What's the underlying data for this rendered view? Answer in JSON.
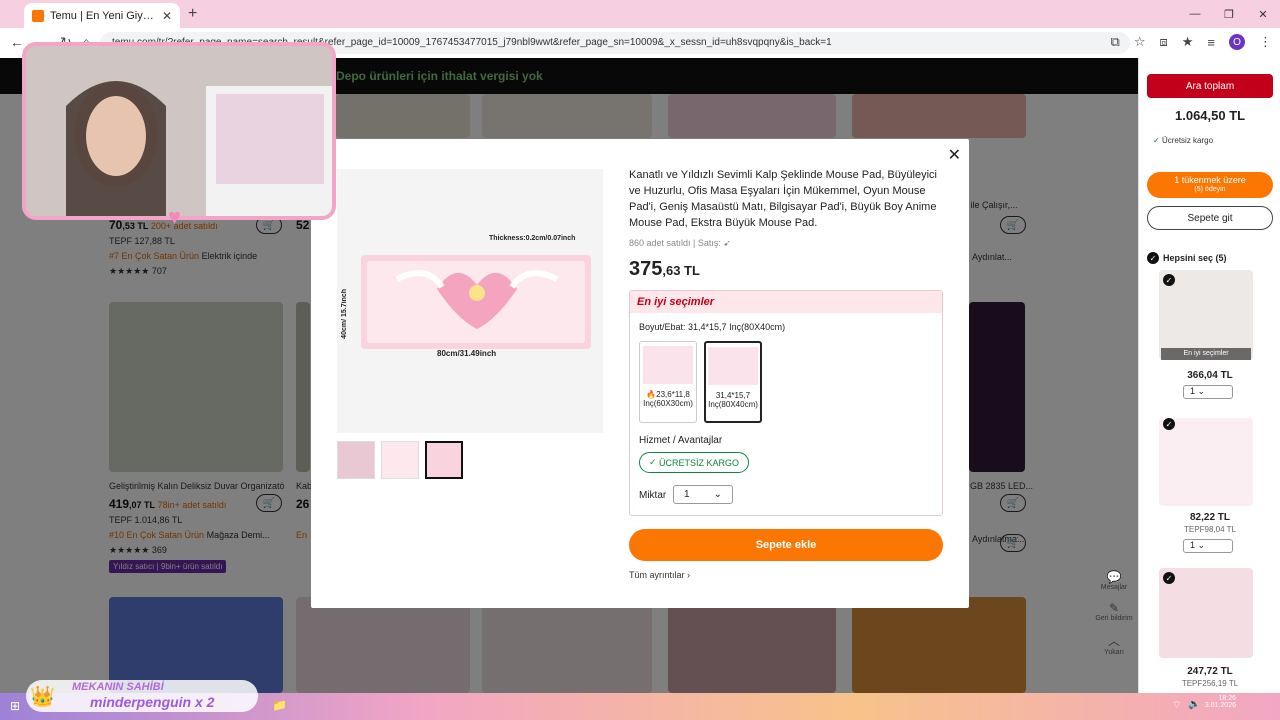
{
  "browser": {
    "tab_title": "Temu | En Yeni Giyim, Güzellik, Ev",
    "url": "temu.com/tr/?refer_page_name=search_result&refer_page_id=10009_1767453477015_j79nbl9wwt&refer_page_sn=10009&_x_sessn_id=uh8svqpqny&is_back=1",
    "profile_initial": "O"
  },
  "banner": {
    "text": "Depo ürünleri için ithalat vergisi yok"
  },
  "grid": {
    "items": [
      {
        "price_main": "70",
        "price_dec": ",53 TL",
        "sold": "200+ adet satıldı",
        "orig": "TEPF 127,88 TL",
        "rank": "#7 En Çok Satan Ürün",
        "rank_cat": "Elektrik içinde",
        "rating_count": "707"
      },
      {
        "title": "Geliştirilmiş Kalın Deliksiz Duvar Organizatö...",
        "price_main": "419",
        "price_dec": ",07 TL",
        "sold": "78in+ adet satıldı",
        "orig": "TEPF 1.014,86 TL",
        "rank": "#10 En Çok Satan Ürün",
        "rank_cat": "Mağaza Demi...",
        "rating_count": "369",
        "badge": "Yıldız satıcı | 9bin+ ürün satıldı"
      }
    ],
    "partial_texts": [
      "52",
      "Kab",
      "26",
      "En",
      "Pil ile Çalışır,...",
      "Aydınlat...",
      "GB 2835 LED...",
      "Aydınlatma..."
    ]
  },
  "sidecart": {
    "subtotal_label": "Ara toplam",
    "subtotal_amount": "1.064,50 TL",
    "free_shipping": "Ücretsiz kargo",
    "stock_title": "1 tükenmek üzere",
    "stock_sub": "(5) ödeyin",
    "go_cart": "Sepete git",
    "select_all": "Hepsini seç (5)",
    "items": [
      {
        "price": "366,04 TL",
        "orig": "",
        "qty": "1",
        "tag": "En iyi seçimler"
      },
      {
        "price": "82,22 TL",
        "orig": "TEPF98,04 TL",
        "qty": "1"
      },
      {
        "price": "247,72 TL",
        "orig": "TEPF256,19 TL"
      }
    ]
  },
  "floattools": {
    "messages": "Mesajlar",
    "feedback": "Geri bildirim",
    "top": "Yukarı"
  },
  "modal": {
    "title": "Kanatlı ve Yıldızlı Sevimli Kalp Şeklinde Mouse Pad, Büyüleyici ve Huzurlu, Ofis Masa Eşyaları İçin Mükemmel, Oyun Mouse Pad'i, Geniş Masaüstü Matı, Bilgisayar Pad'i, Büyük Boy Anime Mouse Pad, Ekstra Büyük Mouse Pad.",
    "sold": "860 adet satıldı | Satış:",
    "price_main": "375",
    "price_dec": ",63 TL",
    "image": {
      "thickness": "Thickness:0.2cm/0.07inch",
      "height": "40cm/ 15.7inch",
      "width": "80cm/31.49inch"
    },
    "options_header": "En iyi seçimler",
    "size_label": "Boyut/Ebat: 31,4*15,7 Inç(80X40cm)",
    "sizes": [
      {
        "label": "23,6*11,8 Inç(60X30cm)",
        "selected": false
      },
      {
        "label": "31,4*15,7 Inç(80X40cm)",
        "selected": true
      }
    ],
    "service_label": "Hizmet / Avantajlar",
    "free_shipping": "ÜCRETSİZ KARGO",
    "qty_label": "Miktar",
    "qty_value": "1",
    "add_to_cart": "Sepete ekle",
    "all_details": "Tüm ayrıntılar"
  },
  "stream": {
    "line1": "MEKANIN SAHİBİ",
    "line2": "minderpenguin x 2"
  },
  "clock": {
    "time": "18:26",
    "date": "3.01.2026"
  }
}
